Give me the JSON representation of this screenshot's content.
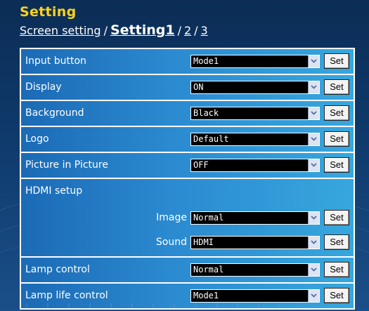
{
  "title": "Setting",
  "breadcrumb": {
    "screen_setting": "Screen setting",
    "sep": "/",
    "current": "Setting1",
    "page2": "2",
    "page3": "3"
  },
  "set_label": "Set",
  "rows": {
    "input_button": {
      "label": "Input button",
      "value": "Mode1"
    },
    "display": {
      "label": "Display",
      "value": "ON"
    },
    "background": {
      "label": "Background",
      "value": "Black"
    },
    "logo": {
      "label": "Logo",
      "value": "Default"
    },
    "pip": {
      "label": "Picture in Picture",
      "value": "OFF"
    },
    "hdmi": {
      "label": "HDMI setup",
      "image_label": "Image",
      "image_value": "Normal",
      "sound_label": "Sound",
      "sound_value": "HDMI"
    },
    "lamp_control": {
      "label": "Lamp control",
      "value": "Normal"
    },
    "lamp_life": {
      "label": "Lamp life control",
      "value": "Mode1"
    }
  },
  "colors": {
    "title": "#ffd11a",
    "row_start": "#1b6ab5",
    "row_end": "#37a7de",
    "background": "#0f3a6c"
  }
}
